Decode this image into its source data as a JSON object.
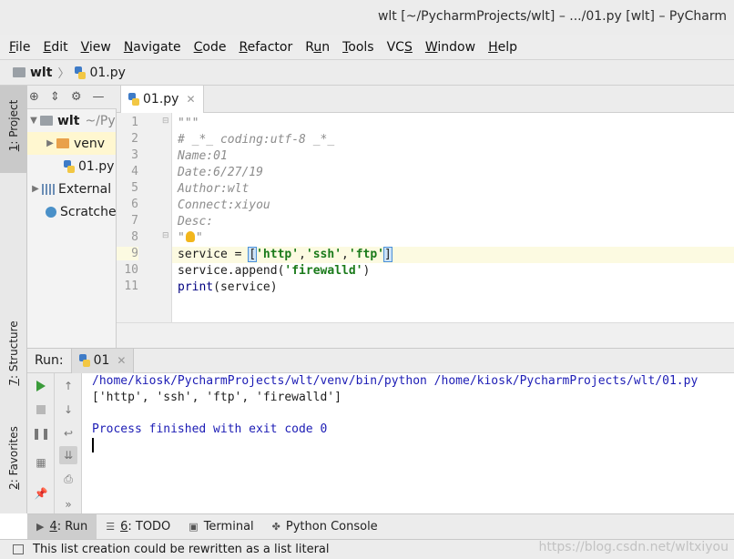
{
  "window": {
    "title": "wlt [~/PycharmProjects/wlt] – .../01.py [wlt] – PyCharm"
  },
  "menu": [
    {
      "pre": "",
      "u": "F",
      "post": "ile"
    },
    {
      "pre": "",
      "u": "E",
      "post": "dit"
    },
    {
      "pre": "",
      "u": "V",
      "post": "iew"
    },
    {
      "pre": "",
      "u": "N",
      "post": "avigate"
    },
    {
      "pre": "",
      "u": "C",
      "post": "ode"
    },
    {
      "pre": "",
      "u": "R",
      "post": "efactor"
    },
    {
      "pre": "R",
      "u": "u",
      "post": "n"
    },
    {
      "pre": "",
      "u": "T",
      "post": "ools"
    },
    {
      "pre": "VC",
      "u": "S",
      "post": ""
    },
    {
      "pre": "",
      "u": "W",
      "post": "indow"
    },
    {
      "pre": "",
      "u": "H",
      "post": "elp"
    }
  ],
  "breadcrumb": {
    "project": "wlt",
    "file": "01.py"
  },
  "left_stripe": {
    "project_num": "1",
    "project_label": ": Project",
    "structure_num": "7",
    "structure_label": ": Structure",
    "favorites_num": "2",
    "favorites_label": ": Favorites"
  },
  "project_tree": {
    "root_name": "wlt",
    "root_path": "~/Py",
    "venv": "venv",
    "file": "01.py",
    "external": "External",
    "scratches": "Scratche"
  },
  "editor": {
    "tab_label": "01.py",
    "line_numbers": [
      "1",
      "2",
      "3",
      "4",
      "5",
      "6",
      "7",
      "8",
      "9",
      "10",
      "11"
    ],
    "lines": {
      "l1": "\"\"\"",
      "l2": "# _*_ coding:utf-8 _*_",
      "l3": "Name:01",
      "l4": "Date:6/27/19",
      "l5": "Author:wlt",
      "l6": "Connect:xiyou",
      "l7": "Desc:",
      "l8a": "\"",
      "l8b": "\"",
      "l9a": "service = ",
      "l9b": "[",
      "l9c": "'http'",
      "l9d": ",",
      "l9e": "'ssh'",
      "l9f": ",",
      "l9g": "'ftp'",
      "l9h": "]",
      "l10a": "service.append(",
      "l10b": "'firewalld'",
      "l10c": ")",
      "l11a": "print",
      "l11b": "(service)"
    },
    "caret_line": 9
  },
  "run_panel": {
    "label": "Run:",
    "tab": "01",
    "output": [
      "/home/kiosk/PycharmProjects/wlt/venv/bin/python /home/kiosk/PycharmProjects/wlt/01.py",
      "['http', 'ssh', 'ftp', 'firewalld']",
      "",
      "Process finished with exit code 0"
    ]
  },
  "bottom_tabs": [
    {
      "glyph": "▶",
      "num": "4",
      "label": ": Run",
      "active": true
    },
    {
      "glyph": "☰",
      "num": "6",
      "label": ": TODO",
      "active": false
    },
    {
      "glyph": "▣",
      "num": "",
      "label": "Terminal",
      "active": false
    },
    {
      "glyph": "✤",
      "num": "",
      "label": "Python Console",
      "active": false
    }
  ],
  "status": {
    "message": "This list creation could be rewritten as a list literal"
  },
  "watermark": "https://blog.csdn.net/wltxiyou",
  "colors": {
    "string": "#1a7a1a",
    "docstring": "#8c8c8c",
    "console_info": "#1c1cb5",
    "caret_row": "#fcfae1"
  }
}
